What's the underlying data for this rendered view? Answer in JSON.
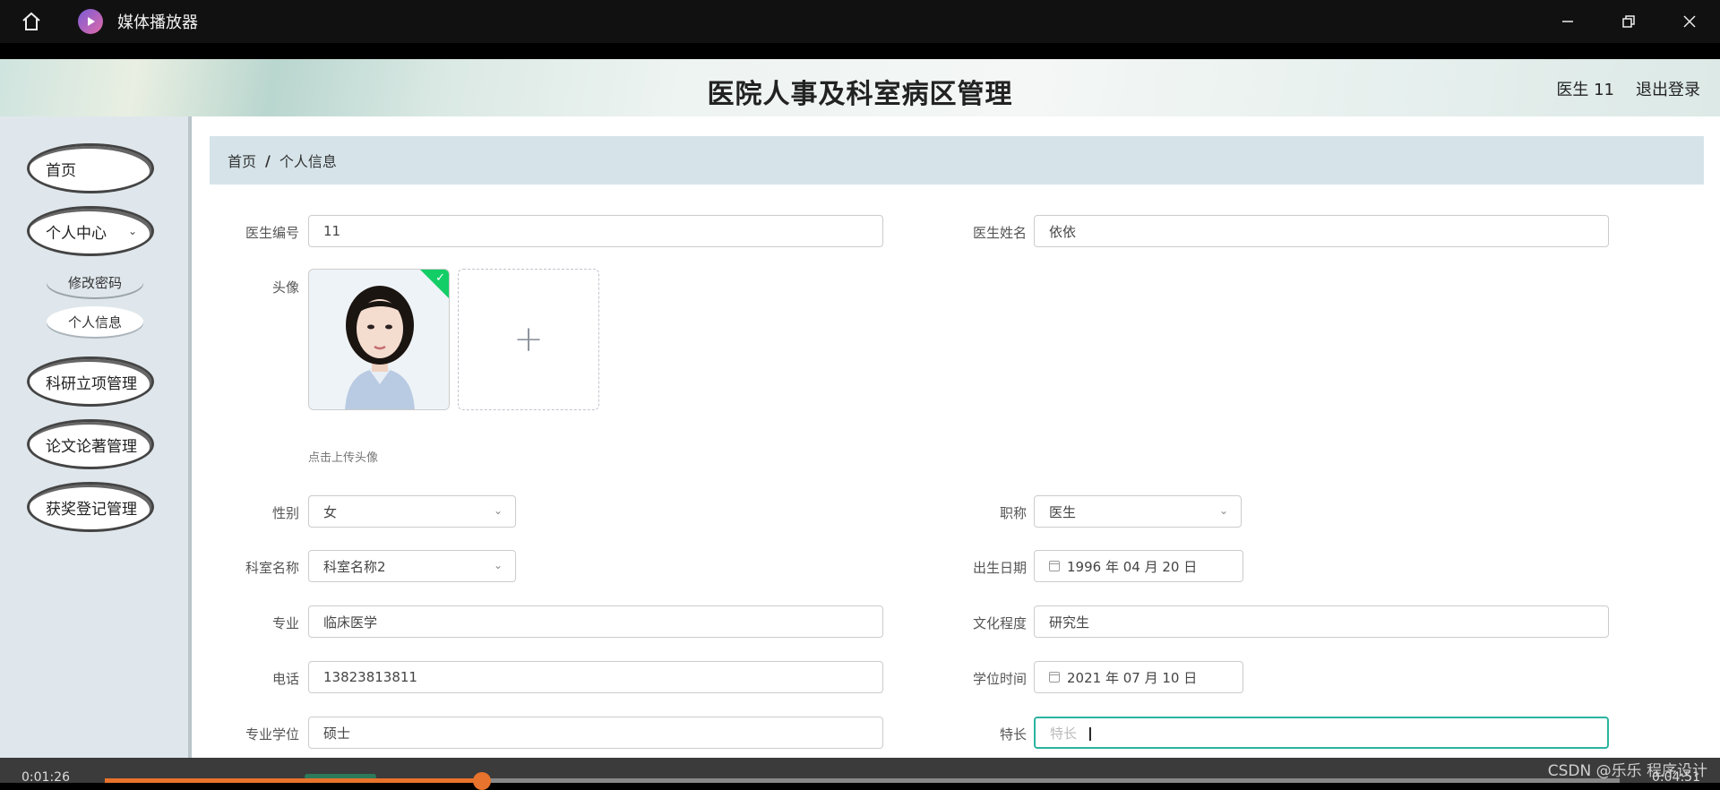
{
  "player": {
    "title": "媒体播放器",
    "current_time": "0:01:26",
    "total_time": "0:04:51",
    "progress": 0.249
  },
  "watermark": "CSDN @乐乐 程序设计",
  "header": {
    "title": "医院人事及科室病区管理",
    "user": "医生 11",
    "logout": "退出登录"
  },
  "sidebar": {
    "home": "首页",
    "personal_center": "个人中心",
    "change_password": "修改密码",
    "personal_info": "个人信息",
    "research": "科研立项管理",
    "papers": "论文论著管理",
    "awards": "获奖登记管理"
  },
  "breadcrumb": {
    "home": "首页",
    "separator": "/",
    "current": "个人信息"
  },
  "form": {
    "doctor_id": {
      "label": "医生编号",
      "value": "11"
    },
    "doctor_name": {
      "label": "医生姓名",
      "value": "依依"
    },
    "avatar": {
      "label": "头像",
      "hint": "点击上传头像",
      "add": "+"
    },
    "gender": {
      "label": "性别",
      "value": "女"
    },
    "title": {
      "label": "职称",
      "value": "医生"
    },
    "department": {
      "label": "科室名称",
      "value": "科室名称2"
    },
    "birth_date": {
      "label": "出生日期",
      "value": "1996 年 04 月 20 日"
    },
    "major": {
      "label": "专业",
      "value": "临床医学"
    },
    "education": {
      "label": "文化程度",
      "value": "研究生"
    },
    "phone": {
      "label": "电话",
      "value": "13823813811"
    },
    "degree_date": {
      "label": "学位时间",
      "value": "2021 年 07 月 10 日"
    },
    "degree": {
      "label": "专业学位",
      "value": "硕士"
    },
    "specialty": {
      "label": "特长",
      "placeholder": "特长"
    }
  }
}
